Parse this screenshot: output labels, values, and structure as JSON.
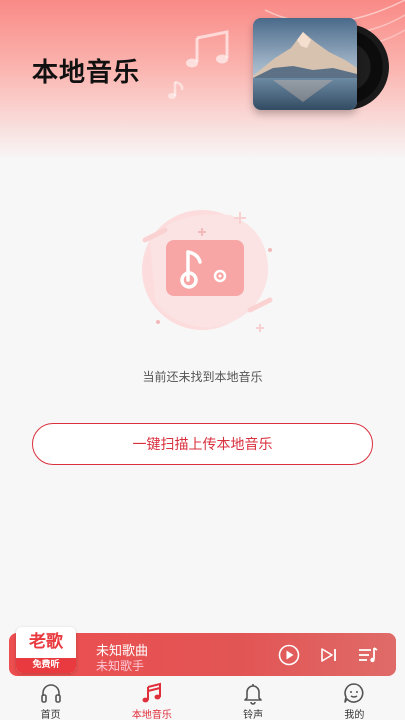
{
  "header": {
    "title": "本地音乐"
  },
  "empty": {
    "message": "当前还未找到本地音乐",
    "scan_button": "一键扫描上传本地音乐"
  },
  "player": {
    "badge_top": "老歌",
    "badge_bottom": "免费听",
    "song_title": "未知歌曲",
    "artist": "未知歌手"
  },
  "tabs": [
    {
      "label": "首页",
      "icon": "headphones-icon",
      "active": false
    },
    {
      "label": "本地音乐",
      "icon": "music-note-icon",
      "active": true
    },
    {
      "label": "铃声",
      "icon": "bell-icon",
      "active": false
    },
    {
      "label": "我的",
      "icon": "smiley-face-icon",
      "active": false
    }
  ],
  "colors": {
    "accent": "#e02e3a",
    "header_gradient_top": "#f98a86",
    "illustration_pink": "#fcdcdc"
  }
}
